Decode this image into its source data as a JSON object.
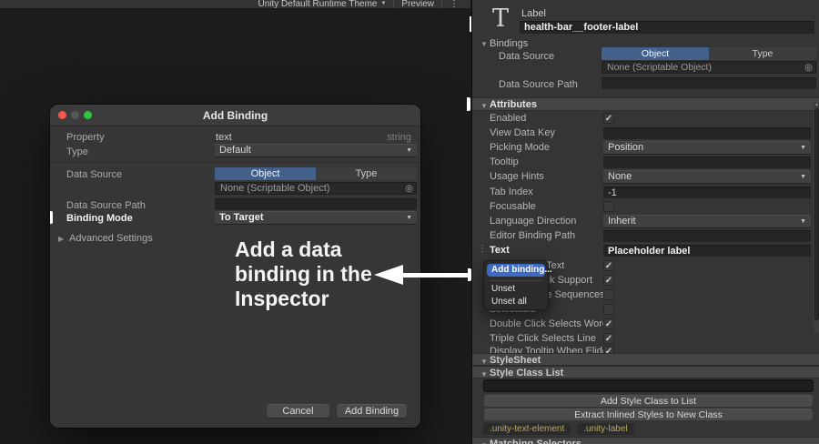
{
  "toolbar": {
    "theme_button": "Unity Default Runtime Theme",
    "preview_button": "Preview",
    "more_icon": "⋮"
  },
  "icons": {
    "fold_open": "▼",
    "fold_closed": "▶",
    "dropdown_caret": "▼",
    "pick": "◎",
    "dots": "⋮",
    "scroll_up": "▲",
    "text_element_icon": "T"
  },
  "dialog": {
    "title": "Add Binding",
    "property_label": "Property",
    "property_value": "text",
    "property_type": "string",
    "type_label": "Type",
    "type_value": "Default",
    "data_source_label": "Data Source",
    "tab_object": "Object",
    "tab_type": "Type",
    "object_value": "None (Scriptable Object)",
    "data_source_path_label": "Data Source Path",
    "binding_mode_label": "Binding Mode",
    "binding_mode_value": "To Target",
    "advanced_label": "Advanced Settings",
    "cancel_button": "Cancel",
    "submit_button": "Add Binding"
  },
  "annotation": {
    "lines": [
      "Add a data",
      "binding in the",
      "Inspector"
    ]
  },
  "inspector": {
    "element_type": "Label",
    "element_name": "health-bar__footer-label",
    "bindings": {
      "title": "Bindings",
      "data_source_label": "Data Source",
      "tab_object": "Object",
      "tab_type": "Type",
      "object_value": "None (Scriptable Object)",
      "data_source_path_label": "Data Source Path"
    },
    "attributes": {
      "title": "Attributes",
      "rows": [
        {
          "label": "Enabled",
          "type": "checkbox",
          "check": "✓"
        },
        {
          "label": "View Data Key",
          "type": "field",
          "value": ""
        },
        {
          "label": "Picking Mode",
          "type": "dropdown",
          "value": "Position"
        },
        {
          "label": "Tooltip",
          "type": "field",
          "value": ""
        },
        {
          "label": "Usage Hints",
          "type": "dropdown",
          "value": "None"
        },
        {
          "label": "Tab Index",
          "type": "field",
          "value": "-1"
        },
        {
          "label": "Focusable",
          "type": "checkbox",
          "check": ""
        },
        {
          "label": "Language Direction",
          "type": "dropdown",
          "value": "Inherit"
        },
        {
          "label": "Editor Binding Path",
          "type": "field",
          "value": ""
        },
        {
          "label": "Text",
          "type": "field",
          "value": "Placeholder label"
        },
        {
          "label": "Enable Rich Text",
          "type": "checkbox",
          "check": "✓"
        },
        {
          "label": "Emoji Fallback Support",
          "type": "checkbox",
          "check": "✓"
        },
        {
          "label": "Parse Escape Sequences",
          "type": "checkbox",
          "check": ""
        },
        {
          "label": "Selectable",
          "type": "checkbox",
          "check": ""
        },
        {
          "label": "Double Click Selects Word",
          "type": "checkbox",
          "check": "✓"
        },
        {
          "label": "Triple Click Selects Line",
          "type": "checkbox",
          "check": "✓"
        },
        {
          "label": "Display Tooltip When Elided",
          "type": "checkbox",
          "check": "✓"
        }
      ]
    },
    "context_menu": {
      "add_binding": "Add binding...",
      "unset": "Unset",
      "unset_all": "Unset all"
    },
    "stylesheet": {
      "title": "StyleSheet",
      "class_list_title": "Style Class List",
      "add_button": "Add Style Class to List",
      "extract_button": "Extract Inlined Styles to New Class",
      "tags": [
        ".unity-text-element",
        ".unity-label"
      ],
      "matching_title": "Matching Selectors"
    }
  },
  "colors": {
    "accent_tab_blue": "#42608a",
    "menu_highlight_blue": "#3d6bc4",
    "panel_bg": "#353535",
    "header_bg": "#454545",
    "field_bg": "#242424",
    "tag_text": "#b3aa60",
    "traffic_red": "#f4574f",
    "traffic_gray": "#575757",
    "traffic_green": "#33c63f"
  }
}
